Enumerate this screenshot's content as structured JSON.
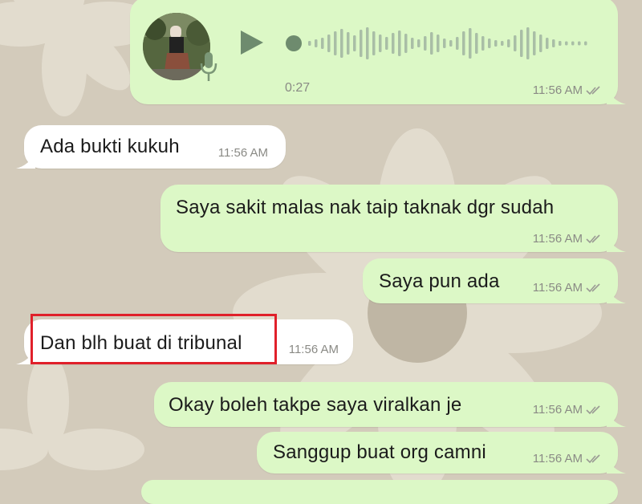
{
  "voice_note": {
    "duration": "0:27",
    "time": "11:56 AM",
    "direction": "outgoing",
    "status": "read"
  },
  "messages": [
    {
      "text": "Ada bukti kukuh",
      "time": "11:56 AM",
      "direction": "incoming"
    },
    {
      "text": "Saya sakit malas nak taip taknak dgr sudah",
      "time": "11:56 AM",
      "direction": "outgoing",
      "status": "read"
    },
    {
      "text": "Saya pun ada",
      "time": "11:56 AM",
      "direction": "outgoing",
      "status": "read"
    },
    {
      "text": "Dan blh buat di tribunal",
      "time": "11:56 AM",
      "direction": "incoming",
      "highlighted": true
    },
    {
      "text": "Okay boleh takpe saya viralkan je",
      "time": "11:56 AM",
      "direction": "outgoing",
      "status": "read"
    },
    {
      "text": "Sanggup buat org camni",
      "time": "11:56 AM",
      "direction": "outgoing",
      "status": "read"
    }
  ],
  "colors": {
    "wallpaper": "#d3cbbb",
    "incoming_bubble": "#ffffff",
    "outgoing_bubble": "#dcf8c6",
    "highlight": "#e0202a",
    "voice_accent": "#6e8b6e"
  },
  "icons": {
    "play": "play-icon",
    "mic": "microphone-icon",
    "ticks": "double-check-icon"
  }
}
